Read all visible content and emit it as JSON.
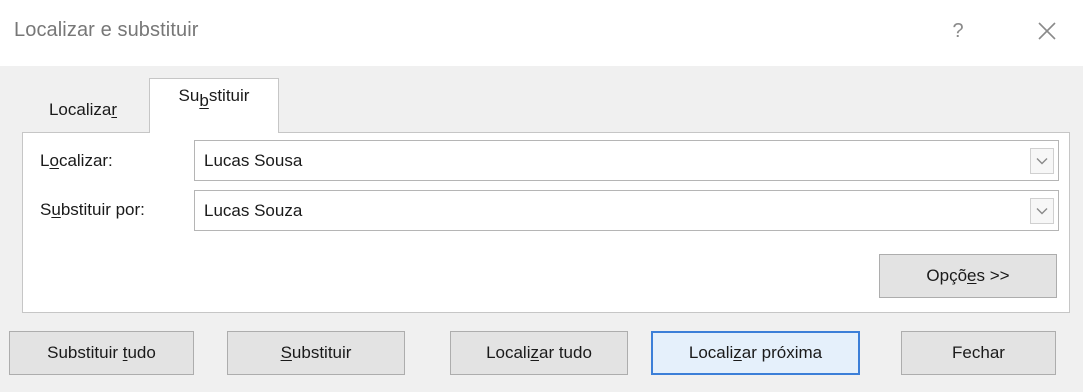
{
  "window": {
    "title": "Localizar e substituir",
    "help_label": "?",
    "close_icon": "close-icon"
  },
  "tabs": [
    {
      "label_pre": "Localiza",
      "label_ul": "r",
      "label_post": "",
      "selected": false
    },
    {
      "label_pre": "Su",
      "label_ul": "b",
      "label_post": "stituir",
      "selected": true
    }
  ],
  "form": {
    "find": {
      "label_pre": "L",
      "label_ul": "o",
      "label_post": "calizar:",
      "value": "Lucas Sousa"
    },
    "replace": {
      "label_pre": "S",
      "label_ul": "u",
      "label_post": "bstituir por:",
      "value": "Lucas Souza"
    }
  },
  "buttons": {
    "options": {
      "pre": "Opçõ",
      "ul": "e",
      "post": "s >>"
    },
    "replace_all": {
      "pre": "Substituir ",
      "ul": "t",
      "post": "udo"
    },
    "replace": {
      "pre": "",
      "ul": "S",
      "post": "ubstituir"
    },
    "find_all": {
      "pre": "Locali",
      "ul": "z",
      "post": "ar tudo"
    },
    "find_next": {
      "pre": "Locali",
      "ul": "z",
      "post": "ar próxima"
    },
    "close": {
      "pre": "Fechar",
      "ul": "",
      "post": ""
    }
  },
  "colors": {
    "panel_bg": "#f0f0f0",
    "focus_border": "#3c7fd8",
    "button_bg": "#e3e3e3"
  }
}
